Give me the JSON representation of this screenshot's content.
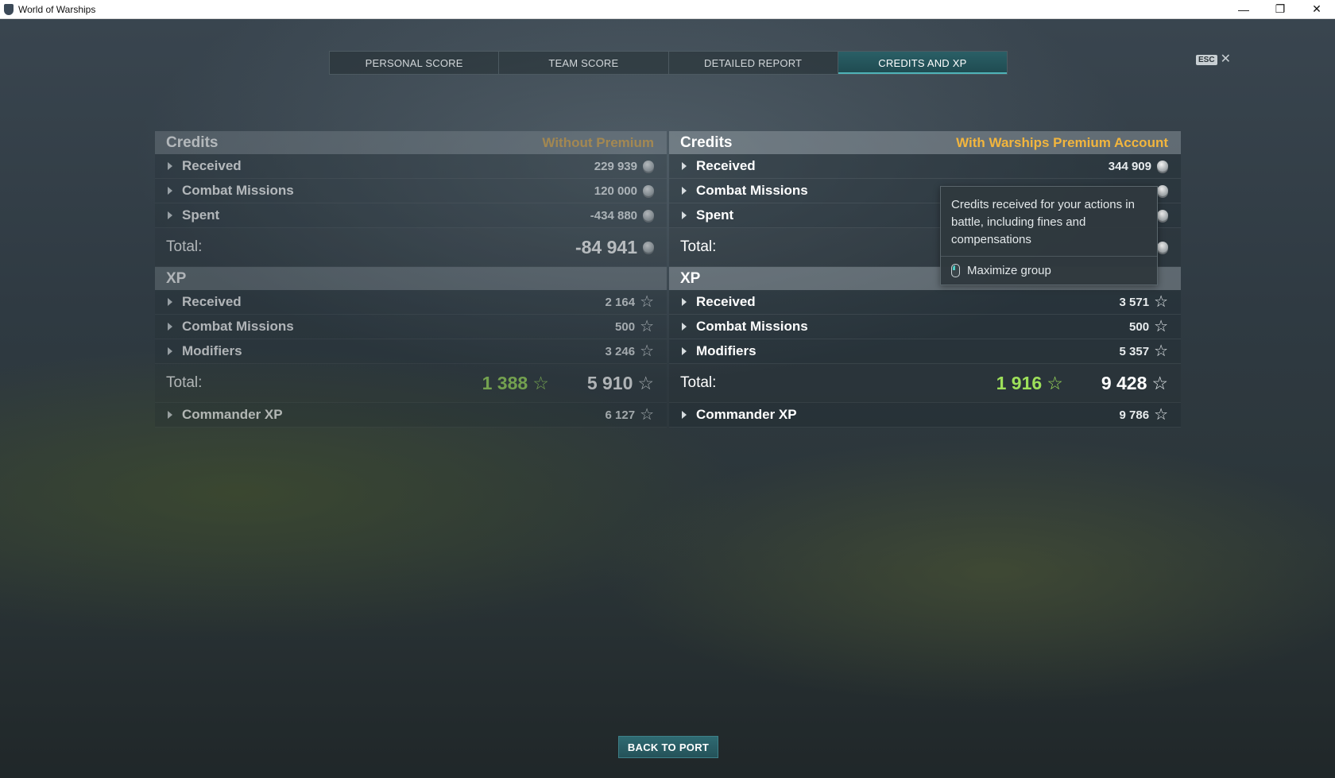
{
  "window": {
    "title": "World of Warships",
    "minimize": "—",
    "restore": "❐",
    "close": "✕"
  },
  "tabs": [
    {
      "label": "PERSONAL SCORE"
    },
    {
      "label": "TEAM SCORE"
    },
    {
      "label": "DETAILED REPORT"
    },
    {
      "label": "CREDITS AND XP",
      "active": true
    }
  ],
  "esc": {
    "key": "ESC",
    "close": "✕"
  },
  "left": {
    "credits_title": "Credits",
    "premium_label": "Without Premium",
    "credits_rows": [
      {
        "label": "Received",
        "value": "229 939"
      },
      {
        "label": "Combat Missions",
        "value": "120 000"
      },
      {
        "label": "Spent",
        "value": "-434 880"
      }
    ],
    "credits_total_label": "Total:",
    "credits_total": "-84 941",
    "xp_title": "XP",
    "xp_rows": [
      {
        "label": "Received",
        "value": "2 164"
      },
      {
        "label": "Combat Missions",
        "value": "500"
      },
      {
        "label": "Modifiers",
        "value": "3 246"
      }
    ],
    "xp_total_label": "Total:",
    "xp_total_green": "1 388",
    "xp_total": "5 910",
    "commander_label": "Commander XP",
    "commander_value": "6 127"
  },
  "right": {
    "credits_title": "Credits",
    "premium_label": "With Warships Premium Account",
    "credits_rows": [
      {
        "label": "Received",
        "value": "344 909"
      },
      {
        "label": "Combat Missions",
        "value": ""
      },
      {
        "label": "Spent",
        "value": ""
      }
    ],
    "credits_total_label": "Total:",
    "xp_title": "XP",
    "xp_rows": [
      {
        "label": "Received",
        "value": "3 571"
      },
      {
        "label": "Combat Missions",
        "value": "500"
      },
      {
        "label": "Modifiers",
        "value": "5 357"
      }
    ],
    "xp_total_label": "Total:",
    "xp_total_green": "1 916",
    "xp_total": "9 428",
    "commander_label": "Commander XP",
    "commander_value": "9 786"
  },
  "tooltip": {
    "text": "Credits received for your actions in battle, including fines and compensations",
    "hint": "Maximize group"
  },
  "footer": {
    "back_label": "BACK TO PORT"
  },
  "colors": {
    "premium_gold": "#f2b53d",
    "xp_green": "#9ee05a",
    "tab_active": "#2a5f66"
  },
  "icons": {
    "credits": "credits-coin-icon",
    "xp": "xp-star-icon",
    "expand": "chevron-right-icon"
  }
}
